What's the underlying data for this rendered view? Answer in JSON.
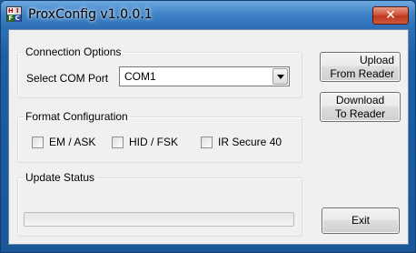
{
  "window": {
    "title": "ProxConfig v1.0.0.1",
    "icon_name": "proxconfig-app-icon",
    "icon_letters": [
      "H",
      "I",
      "F",
      "C"
    ],
    "close_glyph": "✕"
  },
  "connection": {
    "group_label": "Connection Options",
    "port_label": "Select COM Port",
    "port_value": "COM1"
  },
  "format": {
    "group_label": "Format Configuration",
    "options": [
      {
        "label": "EM / ASK",
        "checked": false
      },
      {
        "label": "HID / FSK",
        "checked": false
      },
      {
        "label": "IR Secure 40",
        "checked": false
      }
    ]
  },
  "status": {
    "group_label": "Update Status",
    "progress": 0
  },
  "buttons": {
    "upload": [
      "Upload",
      "From Reader"
    ],
    "download": [
      "Download",
      "To Reader"
    ],
    "exit": "Exit"
  },
  "colors": {
    "title_bar": "#3f82c6",
    "close_button": "#c0381e",
    "dialog_bg": "#f0f0f0"
  }
}
